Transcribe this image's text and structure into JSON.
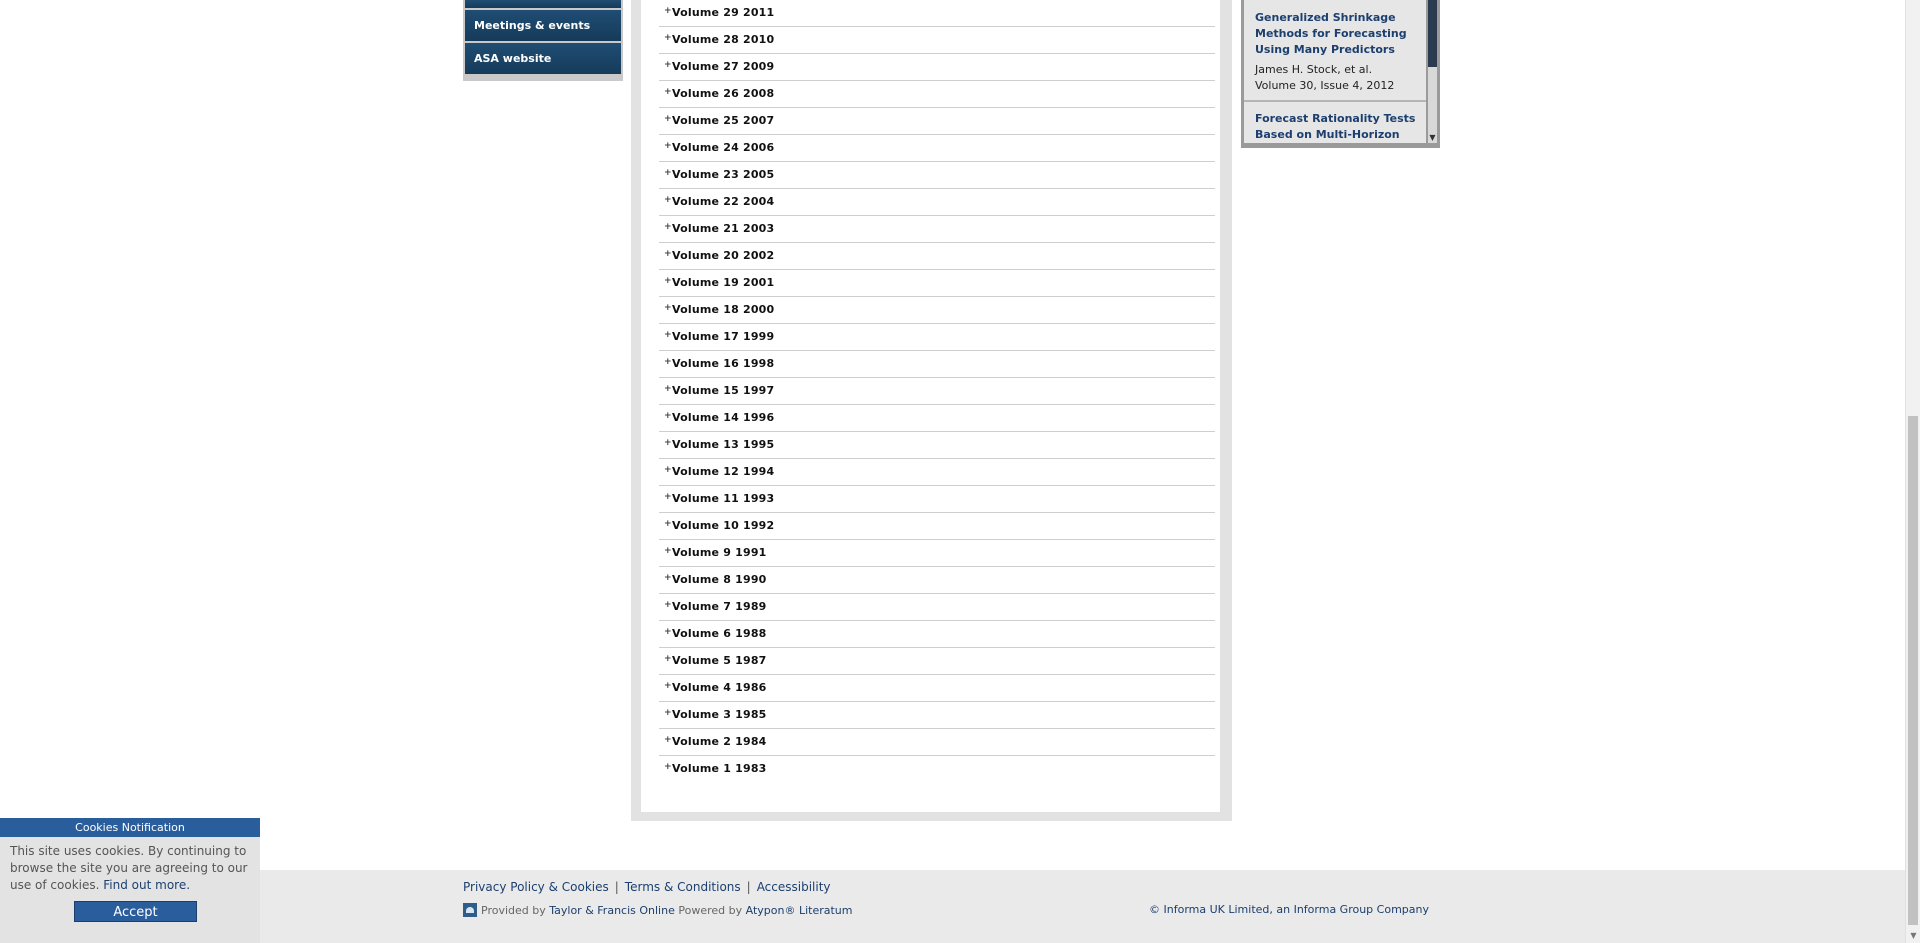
{
  "sidebar": {
    "items": [
      {
        "label": ""
      },
      {
        "label": "Meetings & events"
      },
      {
        "label": "ASA website"
      }
    ]
  },
  "volumes": [
    "Volume 29 2011",
    "Volume 28 2010",
    "Volume 27 2009",
    "Volume 26 2008",
    "Volume 25 2007",
    "Volume 24 2006",
    "Volume 23 2005",
    "Volume 22 2004",
    "Volume 21 2003",
    "Volume 20 2002",
    "Volume 19 2001",
    "Volume 18 2000",
    "Volume 17 1999",
    "Volume 16 1998",
    "Volume 15 1997",
    "Volume 14 1996",
    "Volume 13 1995",
    "Volume 12 1994",
    "Volume 11 1993",
    "Volume 10 1992",
    "Volume 9 1991",
    "Volume 8 1990",
    "Volume 7 1989",
    "Volume 6 1988",
    "Volume 5 1987",
    "Volume 4 1986",
    "Volume 3 1985",
    "Volume 2 1984",
    "Volume 1 1983"
  ],
  "expand_icon": "+",
  "widget": {
    "articles": [
      {
        "title": "Generalized Shrinkage Methods for Forecasting Using Many Predictors",
        "author": "James H. Stock, et al.",
        "issue": "Volume 30, Issue 4, 2012"
      },
      {
        "title": "Forecast Rationality Tests Based on Multi-Horizon",
        "author": "",
        "issue": ""
      }
    ]
  },
  "footer": {
    "links": [
      "Privacy Policy & Cookies",
      "Terms & Conditions",
      "Accessibility"
    ],
    "provided_prefix": "Provided by",
    "provider": "Taylor & Francis Online",
    "powered_prefix": "Powered by",
    "powered": "Atypon® Literatum",
    "copyright": "© Informa UK Limited, an Informa Group Company"
  },
  "cookie": {
    "heading": "Cookies Notification",
    "text": "This site uses cookies. By continuing to browse the site you are agreeing to our use of cookies.",
    "find_out": "Find out more.",
    "accept": "Accept"
  },
  "colors": {
    "nav_bg": "#1f4d73",
    "link": "#1c3f6e",
    "cookie_accent": "#2a5d9c"
  }
}
